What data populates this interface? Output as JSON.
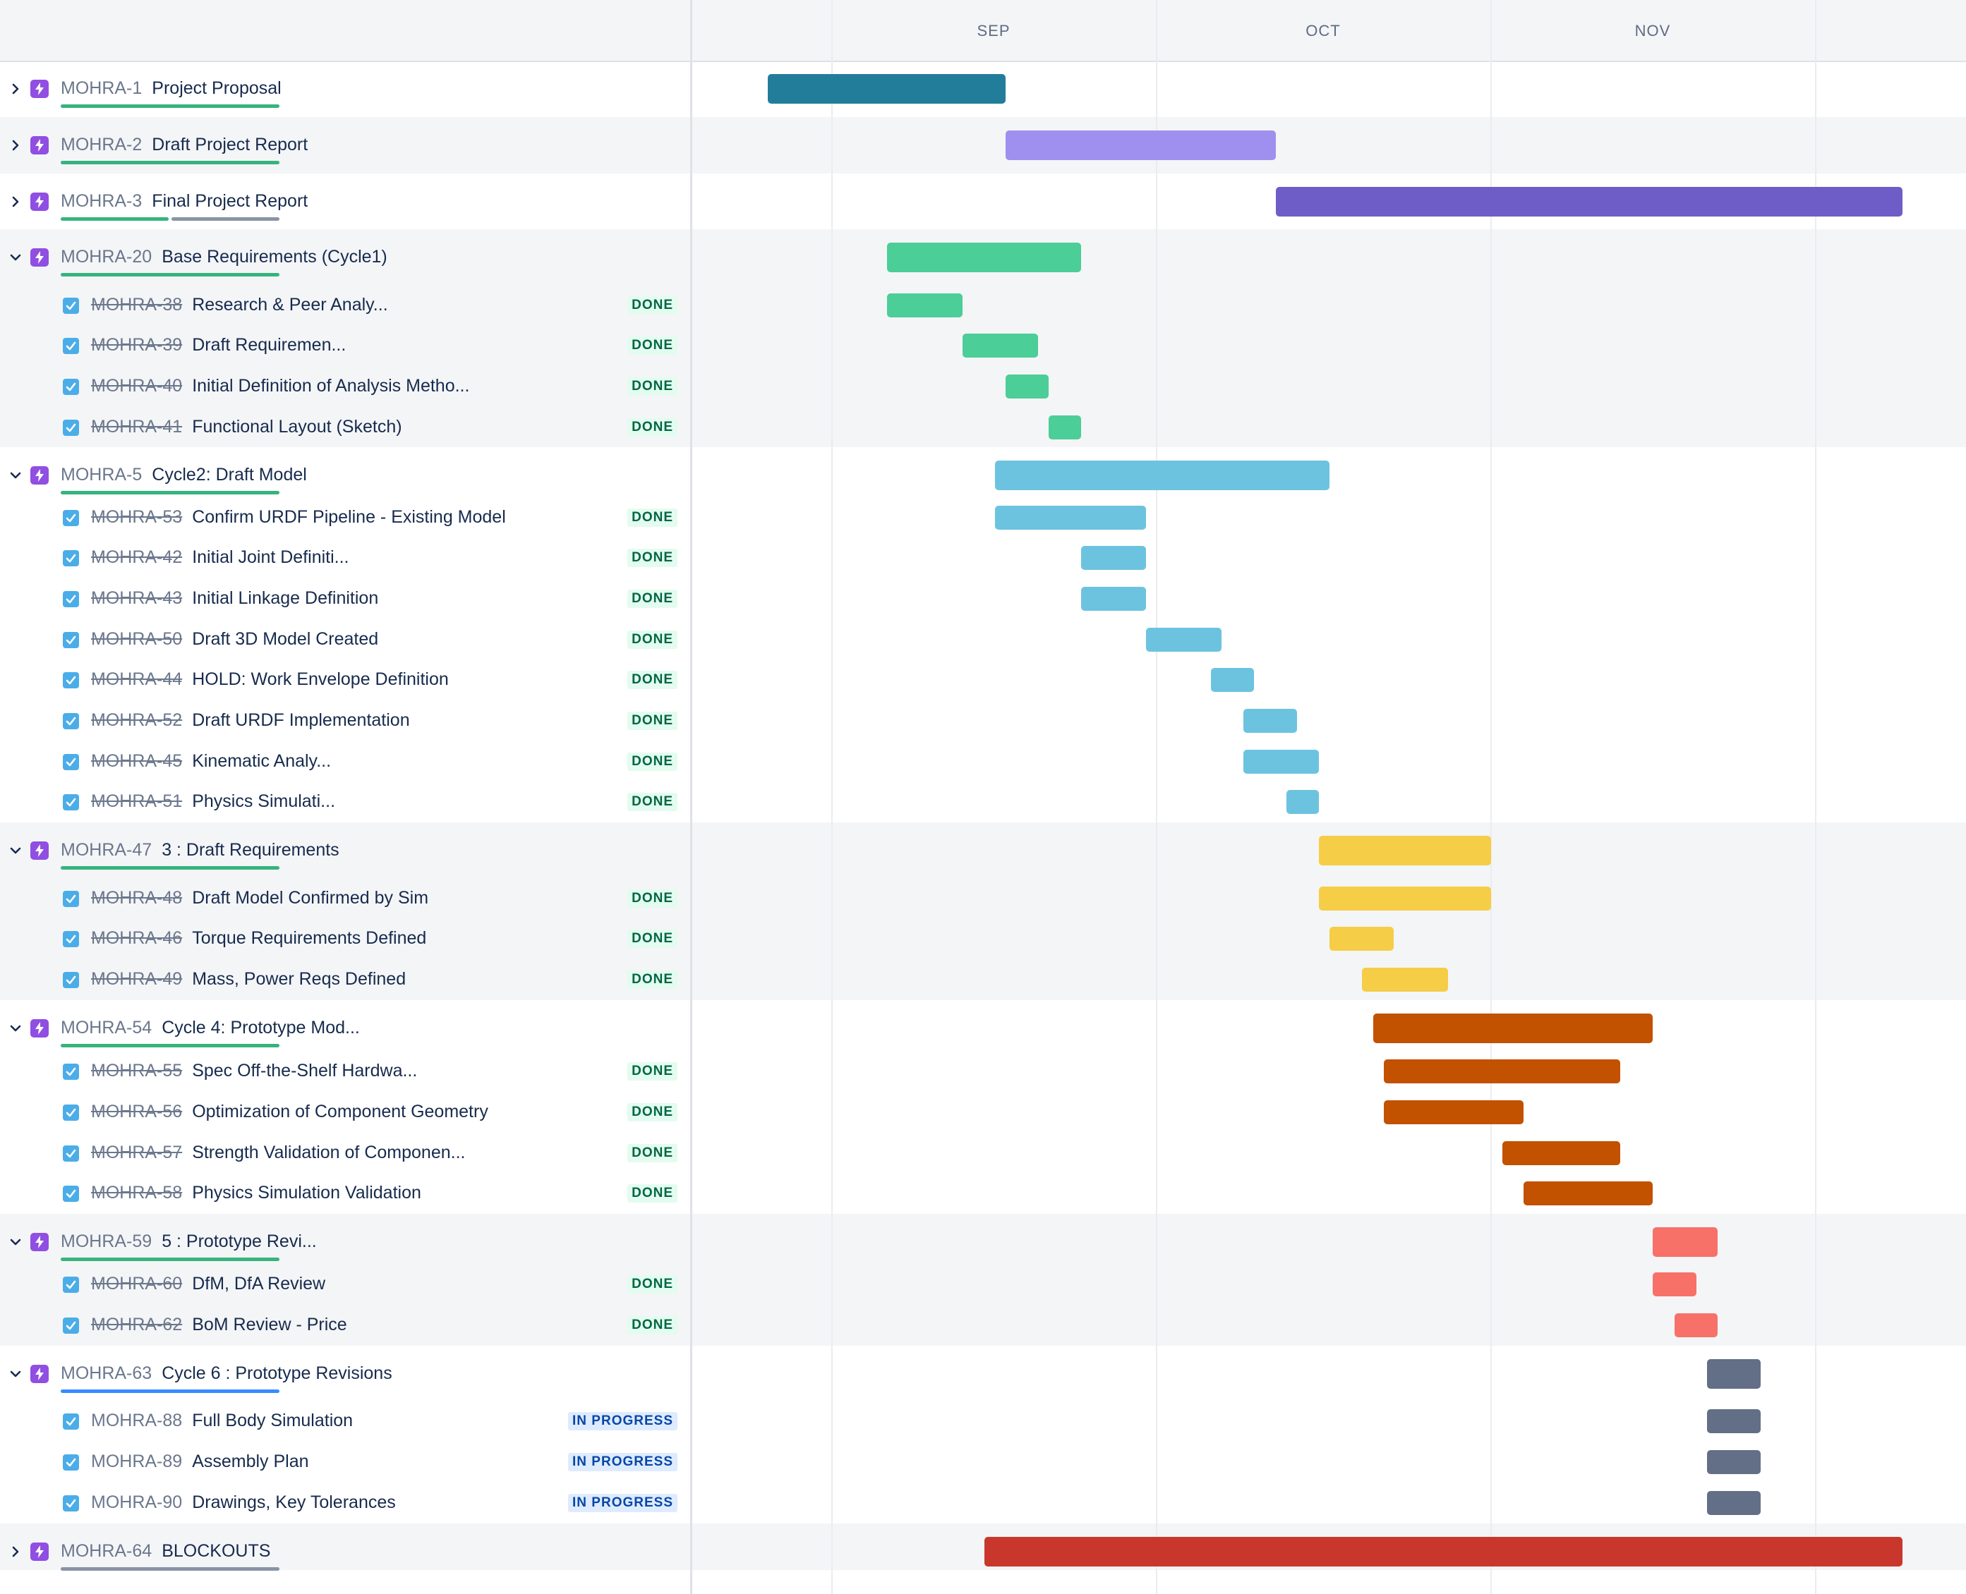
{
  "timeline": {
    "months": [
      "SEP",
      "OCT",
      "NOV"
    ]
  },
  "rows": [
    {
      "type": "epic",
      "expanded": false,
      "key": "MOHRA-1",
      "title": "Project Proposal",
      "progress_color": "#36b37e",
      "bar_color": "#227d9b"
    },
    {
      "type": "epic",
      "expanded": false,
      "key": "MOHRA-2",
      "title": "Draft Project Report",
      "progress_color": "#36b37e",
      "bar_color": "#9f8fef"
    },
    {
      "type": "epic",
      "expanded": false,
      "key": "MOHRA-3",
      "title": "Final Project Report",
      "progress_color": "#36b37e",
      "progress_rest_color": "#8993a4",
      "bar_color": "#6e5dc6"
    },
    {
      "type": "epic",
      "expanded": true,
      "key": "MOHRA-20",
      "title": "Base Requirements (Cycle1)",
      "progress_color": "#36b37e",
      "bar_color": "#4bce97"
    },
    {
      "type": "issue",
      "key": "MOHRA-38",
      "title": "Research & Peer Analy...",
      "status": "DONE",
      "bar_color": "#4bce97"
    },
    {
      "type": "issue",
      "key": "MOHRA-39",
      "title": "Draft Requiremen...",
      "status": "DONE",
      "bar_color": "#4bce97"
    },
    {
      "type": "issue",
      "key": "MOHRA-40",
      "title": "Initial Definition of Analysis Metho...",
      "status": "DONE",
      "bar_color": "#4bce97"
    },
    {
      "type": "issue",
      "key": "MOHRA-41",
      "title": "Functional Layout (Sketch)",
      "status": "DONE",
      "bar_color": "#4bce97"
    },
    {
      "type": "epic",
      "expanded": true,
      "key": "MOHRA-5",
      "title": "Cycle2: Draft Model",
      "progress_color": "#36b37e",
      "bar_color": "#6cc3e0"
    },
    {
      "type": "issue",
      "key": "MOHRA-53",
      "title": "Confirm URDF Pipeline - Existing Model",
      "status": "DONE",
      "bar_color": "#6cc3e0"
    },
    {
      "type": "issue",
      "key": "MOHRA-42",
      "title": "Initial Joint Definiti...",
      "status": "DONE",
      "bar_color": "#6cc3e0"
    },
    {
      "type": "issue",
      "key": "MOHRA-43",
      "title": "Initial Linkage Definition",
      "status": "DONE",
      "bar_color": "#6cc3e0"
    },
    {
      "type": "issue",
      "key": "MOHRA-50",
      "title": "Draft 3D Model Created",
      "status": "DONE",
      "bar_color": "#6cc3e0"
    },
    {
      "type": "issue",
      "key": "MOHRA-44",
      "title": "HOLD: Work Envelope Definition",
      "status": "DONE",
      "bar_color": "#6cc3e0"
    },
    {
      "type": "issue",
      "key": "MOHRA-52",
      "title": "Draft URDF Implementation",
      "status": "DONE",
      "bar_color": "#6cc3e0"
    },
    {
      "type": "issue",
      "key": "MOHRA-45",
      "title": "Kinematic Analy...",
      "status": "DONE",
      "bar_color": "#6cc3e0"
    },
    {
      "type": "issue",
      "key": "MOHRA-51",
      "title": "Physics Simulati...",
      "status": "DONE",
      "bar_color": "#6cc3e0"
    },
    {
      "type": "epic",
      "expanded": true,
      "key": "MOHRA-47",
      "title": "3 : Draft Requirements",
      "progress_color": "#36b37e",
      "bar_color": "#f5cd47"
    },
    {
      "type": "issue",
      "key": "MOHRA-48",
      "title": "Draft Model Confirmed by Sim",
      "status": "DONE",
      "bar_color": "#f5cd47"
    },
    {
      "type": "issue",
      "key": "MOHRA-46",
      "title": "Torque Requirements Defined",
      "status": "DONE",
      "bar_color": "#f5cd47"
    },
    {
      "type": "issue",
      "key": "MOHRA-49",
      "title": "Mass, Power Reqs Defined",
      "status": "DONE",
      "bar_color": "#f5cd47"
    },
    {
      "type": "epic",
      "expanded": true,
      "key": "MOHRA-54",
      "title": "Cycle 4: Prototype Mod...",
      "progress_color": "#36b37e",
      "bar_color": "#c25100"
    },
    {
      "type": "issue",
      "key": "MOHRA-55",
      "title": "Spec Off-the-Shelf Hardwa...",
      "status": "DONE",
      "bar_color": "#c25100"
    },
    {
      "type": "issue",
      "key": "MOHRA-56",
      "title": "Optimization of Component Geometry",
      "status": "DONE",
      "bar_color": "#c25100"
    },
    {
      "type": "issue",
      "key": "MOHRA-57",
      "title": "Strength Validation of Componen...",
      "status": "DONE",
      "bar_color": "#c25100"
    },
    {
      "type": "issue",
      "key": "MOHRA-58",
      "title": "Physics Simulation Validation",
      "status": "DONE",
      "bar_color": "#c25100"
    },
    {
      "type": "epic",
      "expanded": true,
      "key": "MOHRA-59",
      "title": "5 : Prototype Revi...",
      "progress_color": "#36b37e",
      "bar_color": "#f87168"
    },
    {
      "type": "issue",
      "key": "MOHRA-60",
      "title": "DfM, DfA Review",
      "status": "DONE",
      "bar_color": "#f87168"
    },
    {
      "type": "issue",
      "key": "MOHRA-62",
      "title": "BoM Review - Price",
      "status": "DONE",
      "bar_color": "#f87168"
    },
    {
      "type": "epic",
      "expanded": true,
      "key": "MOHRA-63",
      "title": "Cycle 6 : Prototype Revisions",
      "progress_color": "#388bff",
      "bar_color": "#626f86"
    },
    {
      "type": "issue",
      "key": "MOHRA-88",
      "title": "Full Body Simulation",
      "status": "IN PROGRESS",
      "bar_color": "#626f86"
    },
    {
      "type": "issue",
      "key": "MOHRA-89",
      "title": "Assembly Plan",
      "status": "IN PROGRESS",
      "bar_color": "#626f86"
    },
    {
      "type": "issue",
      "key": "MOHRA-90",
      "title": "Drawings, Key Tolerances",
      "status": "IN PROGRESS",
      "bar_color": "#626f86"
    },
    {
      "type": "epic",
      "expanded": false,
      "key": "MOHRA-64",
      "title": "BLOCKOUTS",
      "progress_color": "#8993a4",
      "bar_color": "#c9372c"
    }
  ]
}
